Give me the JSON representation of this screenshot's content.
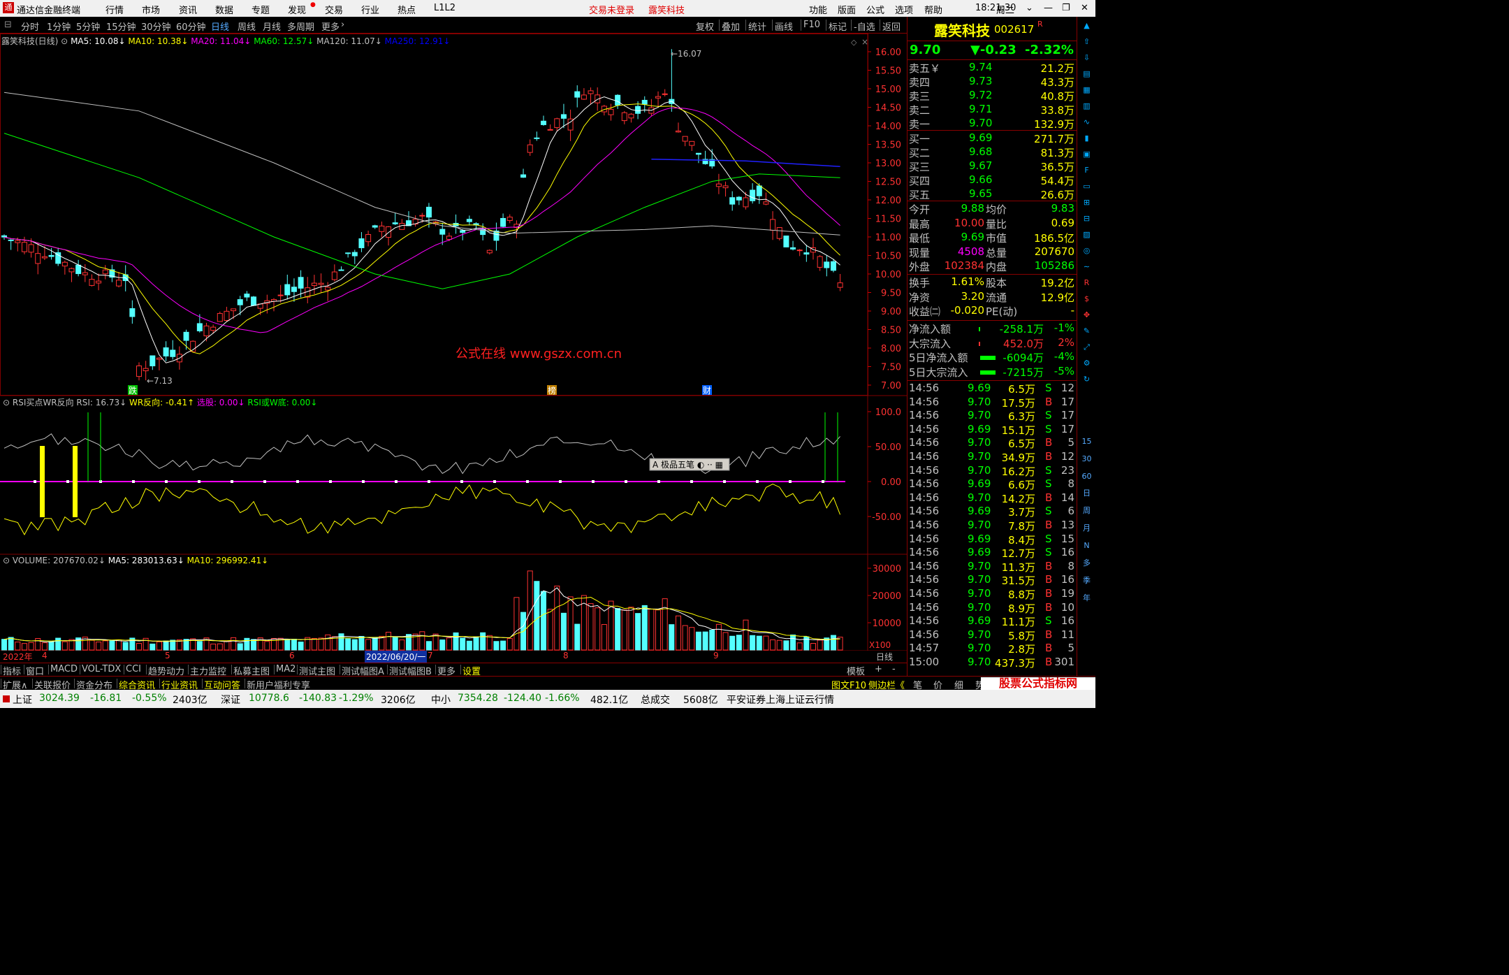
{
  "titlebar": {
    "app_title": "通达信金融终端",
    "menus": [
      "行情",
      "市场",
      "资讯",
      "数据",
      "专题",
      "发现",
      "交易",
      "行业",
      "热点",
      "L1L2"
    ],
    "trade_status": "交易未登录",
    "stock_name": "露笑科技",
    "right_menus": [
      "功能",
      "版面",
      "公式",
      "选项",
      "帮助"
    ],
    "time": "18:21:30",
    "weekday": "周二"
  },
  "periods": [
    "分时",
    "1分钟",
    "5分钟",
    "15分钟",
    "30分钟",
    "60分钟",
    "日线",
    "周线",
    "月线",
    "多周期",
    "更多"
  ],
  "active_period": "日线",
  "toolbar_right": [
    "复权",
    "叠加",
    "统计",
    "画线",
    "F10",
    "标记",
    "-自选",
    "返回"
  ],
  "main_chart": {
    "legend_name": "露笑科技(日线)",
    "ma": [
      {
        "label": "MA5: 10.08",
        "color": "#ffffff"
      },
      {
        "label": "MA10: 10.38",
        "color": "#ffff00"
      },
      {
        "label": "MA20: 11.04",
        "color": "#ff00ff"
      },
      {
        "label": "MA60: 12.57",
        "color": "#00ff00"
      },
      {
        "label": "MA120: 11.07",
        "color": "#c0c0c0"
      },
      {
        "label": "MA250: 12.91",
        "color": "#0000ff"
      }
    ],
    "high_label": "16.07",
    "low_label": "7.13",
    "watermark": "公式在线  www.gszx.com.cn",
    "markers": [
      "跌",
      "榜",
      "财"
    ]
  },
  "chart_data": {
    "type": "candlestick",
    "title": "露笑科技(日线)",
    "ylim": [
      7.0,
      16.0
    ],
    "y_ticks": [
      "16.00",
      "15.50",
      "15.00",
      "14.50",
      "14.00",
      "13.50",
      "13.00",
      "12.50",
      "12.00",
      "11.50",
      "11.00",
      "10.50",
      "10.00",
      "9.50",
      "9.00",
      "8.50",
      "8.00",
      "7.50",
      "7.00"
    ],
    "x_labels": [
      "2022年",
      "4",
      "5",
      "6",
      "2022/06/20/一",
      "7",
      "8",
      "9",
      "日线"
    ],
    "high": 16.07,
    "low": 7.13,
    "last_close": 9.7,
    "rsi_panel": {
      "title": "RSI买点WR反向",
      "legend": [
        {
          "label": "RSI: 16.73",
          "color": "#c0c0c0"
        },
        {
          "label": "WR反向: -0.41",
          "color": "#ffff00"
        },
        {
          "label": "选股: 0.00",
          "color": "#ff00ff"
        },
        {
          "label": "RSI或W底: 0.00",
          "color": "#00ff00"
        }
      ],
      "y_ticks": [
        "100.0",
        "50.00",
        "0.00",
        "-50.00"
      ]
    },
    "volume_panel": {
      "legend": [
        {
          "label": "VOLUME: 207670.02",
          "color": "#c0c0c0"
        },
        {
          "label": "MA5: 283013.63",
          "color": "#ffffff"
        },
        {
          "label": "MA10: 296992.41",
          "color": "#ffff00"
        }
      ],
      "y_ticks": [
        "30000",
        "20000",
        "10000"
      ],
      "unit": "X100"
    },
    "floating_toolbar": "极品五笔"
  },
  "quote": {
    "name": "露笑科技",
    "code": "002617",
    "code_flag": "R",
    "price": "9.70",
    "change": "▼-0.23",
    "pct": "-2.32%",
    "asks": [
      {
        "label": "卖五￥",
        "price": "9.74",
        "vol": "21.2万"
      },
      {
        "label": "卖四",
        "price": "9.73",
        "vol": "43.3万"
      },
      {
        "label": "卖三",
        "price": "9.72",
        "vol": "40.8万"
      },
      {
        "label": "卖二",
        "price": "9.71",
        "vol": "33.8万"
      },
      {
        "label": "卖一",
        "price": "9.70",
        "vol": "132.9万"
      }
    ],
    "bids": [
      {
        "label": "买一",
        "price": "9.69",
        "vol": "271.7万"
      },
      {
        "label": "买二",
        "price": "9.68",
        "vol": "81.3万"
      },
      {
        "label": "买三",
        "price": "9.67",
        "vol": "36.5万"
      },
      {
        "label": "买四",
        "price": "9.66",
        "vol": "54.4万"
      },
      {
        "label": "买五",
        "price": "9.65",
        "vol": "26.6万"
      }
    ],
    "stats1": [
      [
        "今开",
        "9.88",
        "均价",
        "9.83"
      ],
      [
        "最高",
        "10.00",
        "量比",
        "0.69"
      ],
      [
        "最低",
        "9.69",
        "市值",
        "186.5亿"
      ],
      [
        "现量",
        "4508",
        "总量",
        "207670"
      ],
      [
        "外盘",
        "102384",
        "内盘",
        "105286"
      ]
    ],
    "stats2": [
      [
        "换手",
        "1.61%",
        "股本",
        "19.2亿"
      ],
      [
        "净资",
        "3.20",
        "流通",
        "12.9亿"
      ],
      [
        "收益㈡",
        "-0.020",
        "PE(动)",
        "-"
      ]
    ],
    "flows": [
      {
        "label": "净流入额",
        "value": "-258.1万",
        "pct": "-1%"
      },
      {
        "label": "大宗流入",
        "value": "452.0万",
        "pct": "2%"
      },
      {
        "label": "5日净流入额",
        "value": "-6094万",
        "pct": "-4%"
      },
      {
        "label": "5日大宗流入",
        "value": "-7215万",
        "pct": "-5%"
      }
    ],
    "ticks": [
      [
        "14:56",
        "9.69",
        "6.5万",
        "S",
        "12"
      ],
      [
        "14:56",
        "9.70",
        "17.5万",
        "B",
        "17"
      ],
      [
        "14:56",
        "9.70",
        "6.3万",
        "S",
        "17"
      ],
      [
        "14:56",
        "9.69",
        "15.1万",
        "S",
        "17"
      ],
      [
        "14:56",
        "9.70",
        "6.5万",
        "B",
        "5"
      ],
      [
        "14:56",
        "9.70",
        "34.9万",
        "B",
        "12"
      ],
      [
        "14:56",
        "9.70",
        "16.2万",
        "S",
        "23"
      ],
      [
        "14:56",
        "9.69",
        "6.6万",
        "S",
        "8"
      ],
      [
        "14:56",
        "9.70",
        "14.2万",
        "B",
        "14"
      ],
      [
        "14:56",
        "9.69",
        "3.7万",
        "S",
        "6"
      ],
      [
        "14:56",
        "9.70",
        "7.8万",
        "B",
        "13"
      ],
      [
        "14:56",
        "9.69",
        "8.4万",
        "S",
        "15"
      ],
      [
        "14:56",
        "9.69",
        "12.7万",
        "S",
        "16"
      ],
      [
        "14:56",
        "9.70",
        "11.3万",
        "B",
        "8"
      ],
      [
        "14:56",
        "9.70",
        "31.5万",
        "B",
        "16"
      ],
      [
        "14:56",
        "9.70",
        "8.8万",
        "B",
        "19"
      ],
      [
        "14:56",
        "9.70",
        "8.9万",
        "B",
        "10"
      ],
      [
        "14:56",
        "9.69",
        "11.1万",
        "S",
        "16"
      ],
      [
        "14:56",
        "9.70",
        "5.8万",
        "B",
        "11"
      ],
      [
        "14:57",
        "9.70",
        "2.8万",
        "B",
        "5"
      ],
      [
        "15:00",
        "9.70",
        "437.3万",
        "B",
        "301"
      ]
    ]
  },
  "right_icons": [
    "日",
    "周",
    "月",
    "N",
    "多",
    "季",
    "年"
  ],
  "right_icon_nums": [
    "15",
    "30",
    "60"
  ],
  "bottom_tabs": [
    "指标",
    "窗口",
    "MACD",
    "VOL-TDX",
    "CCI",
    "趋势动力",
    "主力监控",
    "私募主图",
    "MA2",
    "测试主图",
    "测试幅图A",
    "测试幅图B",
    "更多",
    "设置"
  ],
  "bottom_right": [
    "模板",
    "+",
    "-"
  ],
  "bottom2_tabs": [
    "扩展∧",
    "关联报价",
    "资金分布",
    "综合资讯",
    "行业资讯",
    "互动问答",
    "新用户福利专享"
  ],
  "bottom2_right": [
    "图文F10",
    "侧边栏《",
    "笔",
    "价",
    "细",
    "势"
  ],
  "logo_text": "股票公式指标网",
  "logo_url": "www.gszx.com.cn",
  "status": {
    "sh_label": "上证",
    "sh": [
      "3024.39",
      "-16.81",
      "-0.55%",
      "2403亿"
    ],
    "sz_label": "深证",
    "sz": [
      "10778.6",
      "-140.83",
      "-1.29%",
      "3206亿"
    ],
    "zx_label": "中小",
    "zx": [
      "7354.28",
      "-124.40",
      "-1.66%",
      "482.1亿"
    ],
    "total_label": "总成交",
    "total": "5608亿",
    "broker": "平安证券上海上证云行情"
  },
  "colors": {
    "up": "#ff3232",
    "down": "#54ffff",
    "ma5": "#ffffff",
    "ma10": "#ffff00",
    "ma20": "#ff00ff",
    "ma60": "#00ff00",
    "ma120": "#c0c0c0",
    "ma250": "#2020ff",
    "grid": "#800000"
  }
}
